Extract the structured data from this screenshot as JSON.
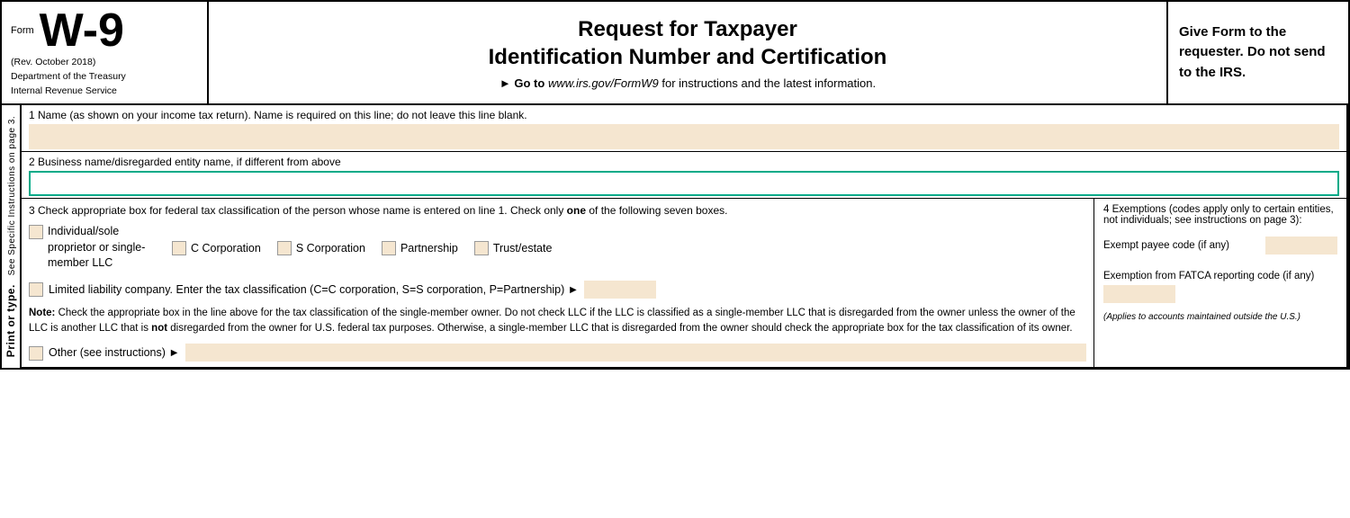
{
  "header": {
    "form_label": "Form",
    "w9_title": "W-9",
    "meta_line1": "(Rev. October 2018)",
    "meta_line2": "Department of the Treasury",
    "meta_line3": "Internal Revenue Service",
    "main_title_line1": "Request for Taxpayer",
    "main_title_line2": "Identification Number and Certification",
    "instruction": "► Go to",
    "instruction_link": "www.irs.gov/FormW9",
    "instruction_suffix": "for instructions and the latest information.",
    "right_text": "Give Form to the requester. Do not send to the IRS."
  },
  "sidebar": {
    "text_part1": "Print or type.",
    "text_part2": "See Specific Instructions on page 3."
  },
  "fields": {
    "field1_label": "1  Name (as shown on your income tax return). Name is required on this line; do not leave this line blank.",
    "field2_label": "2  Business name/disregarded entity name, if different from above",
    "field3_label_start": "3  Check appropriate box for federal tax classification of the person whose name is entered on line 1. Check only ",
    "field3_label_bold": "one",
    "field3_label_end": " of the following seven boxes.",
    "checkbox1_label": "Individual/sole proprietor or single-member LLC",
    "checkbox2_label": "C Corporation",
    "checkbox3_label": "S Corporation",
    "checkbox4_label": "Partnership",
    "checkbox5_label": "Trust/estate",
    "llc_label": "Limited liability company. Enter the tax classification (C=C corporation, S=S corporation, P=Partnership) ►",
    "note_bold": "Note:",
    "note_text": " Check the appropriate box in the line above for the tax classification of the single-member owner.  Do not check LLC if the LLC is classified as a single-member LLC that is disregarded from the owner unless the owner of the LLC is another LLC that is ",
    "note_not_bold": "not",
    "note_text2": " disregarded from the owner for U.S. federal tax purposes. Otherwise, a single-member LLC that is disregarded from the owner should check the appropriate box for the tax classification of its owner.",
    "other_label": "Other (see instructions) ►",
    "exemptions_title": "4  Exemptions (codes apply only to certain entities, not individuals; see instructions on page 3):",
    "exempt_payee_label": "Exempt payee code (if any)",
    "fatca_label": "Exemption from FATCA reporting code (if any)",
    "applies_note": "(Applies to accounts maintained outside the U.S.)"
  }
}
